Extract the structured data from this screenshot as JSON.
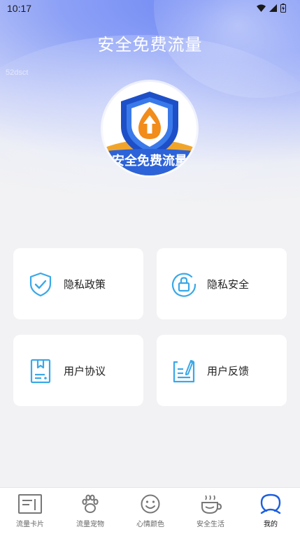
{
  "status_bar": {
    "time": "10:17"
  },
  "header": {
    "title": "安全免费流量",
    "watermark": "52dsct"
  },
  "logo": {
    "banner_text": "安全免费流量"
  },
  "cards": [
    {
      "label": "隐私政策",
      "icon": "shield-check-icon"
    },
    {
      "label": "隐私安全",
      "icon": "lock-icon"
    },
    {
      "label": "用户协议",
      "icon": "agreement-document-icon"
    },
    {
      "label": "用户反馈",
      "icon": "feedback-edit-icon"
    }
  ],
  "tabs": [
    {
      "label": "流量卡片",
      "icon": "card-icon"
    },
    {
      "label": "流量宠物",
      "icon": "paw-icon"
    },
    {
      "label": "心情颜色",
      "icon": "smiley-icon"
    },
    {
      "label": "安全生活",
      "icon": "cup-icon"
    },
    {
      "label": "我的",
      "icon": "user-icon",
      "active": true
    }
  ],
  "colors": {
    "accent": "#2a8ee8",
    "icon_blue": "#3aa8e8",
    "tab_active": "#1c5fe0",
    "tab_inactive": "#777777"
  }
}
